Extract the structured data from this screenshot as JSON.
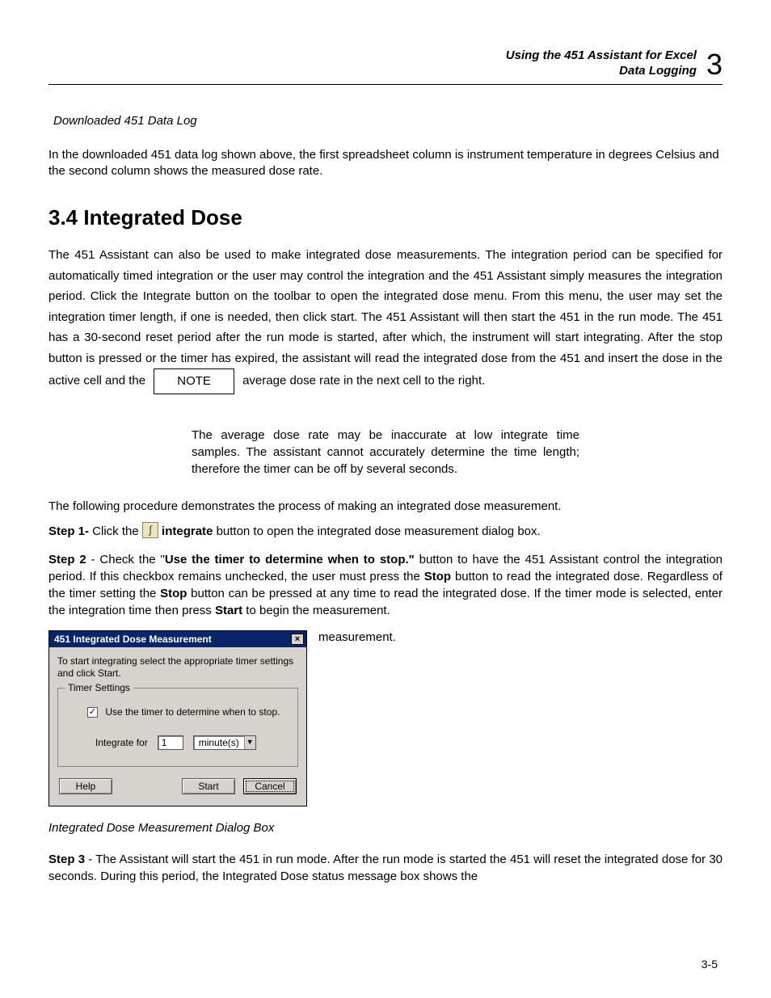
{
  "header": {
    "line1": "Using the 451 Assistant for Excel",
    "line2": "Data Logging",
    "chapter_number": "3"
  },
  "caption1": "Downloaded 451 Data Log",
  "intro_para": "In the downloaded 451 data log shown above, the first spreadsheet column is instrument temperature in degrees Celsius and the second column shows the measured dose rate.",
  "section_heading": "3.4 Integrated Dose",
  "main_para_a": "The 451 Assistant can also be used to make integrated dose measurements.  The integration period can be specified for automatically timed integration or the user may control the integration and the 451 Assistant simply measures the integration period.  Click the Integrate button on the toolbar to open the integrated dose menu.  From this menu, the user may set the integration timer length, if one is needed, then click start.  The 451 Assistant will then start the 451 in the run mode.  The 451 has a 30-second reset period after the run mode is started, after which, the instrument will start integrating.  After the stop button is pressed or the timer has expired, the assistant will read the integrated dose from the 451 and insert the dose in the active cell and the ",
  "note_label": "NOTE",
  "main_para_b": " average dose rate in the next cell to the right.",
  "note_body": "The average dose rate may be inaccurate at low integrate time samples.  The assistant cannot accurately determine the time length; therefore the timer can be off by several seconds.",
  "procedure_line": "The following procedure demonstrates the process of making an integrated dose measurement.",
  "step1": {
    "label": "Step 1-",
    "pre": " Click the ",
    "icon_glyph": "∫",
    "bold_word": " integrate ",
    "post": " button to open the integrated dose measurement dialog box."
  },
  "step2": {
    "label": "Step 2",
    "a": " - Check the \"",
    "bold1": "Use the timer to determine when to stop.\"",
    "b": " button to have the 451 Assistant control the integration period.  If this checkbox remains unchecked, the user must press the ",
    "bold2": "Stop",
    "c": " button to read the integrated dose.  Regardless of the timer setting the ",
    "bold3": "Stop",
    "d": " button can be pressed at any time to read the integrated dose.  If the timer mode is selected, enter the integration time then press ",
    "bold4": "Start",
    "e": " to begin the measurement."
  },
  "dialog": {
    "title": "451 Integrated Dose Measurement",
    "close_glyph": "×",
    "instruction": "To start integrating select the appropriate timer settings and click Start.",
    "legend": "Timer Settings",
    "checkbox_mark": "✓",
    "checkbox_label": "Use the timer to determine when to stop.",
    "integrate_for": "Integrate for",
    "num_value": "1",
    "unit_value": "minute(s)",
    "dropdown_glyph": "▼",
    "btn_help": "Help",
    "btn_start": "Start",
    "btn_cancel": "Cancel"
  },
  "side_word": "measurement.",
  "dialog_caption": "Integrated Dose Measurement Dialog Box",
  "step3": {
    "label": "Step 3",
    "text": " - The Assistant will start the 451 in run mode.  After the run mode is started the 451 will reset the integrated dose for 30 seconds.  During this period, the Integrated Dose status message box shows the"
  },
  "page_number": "3-5"
}
